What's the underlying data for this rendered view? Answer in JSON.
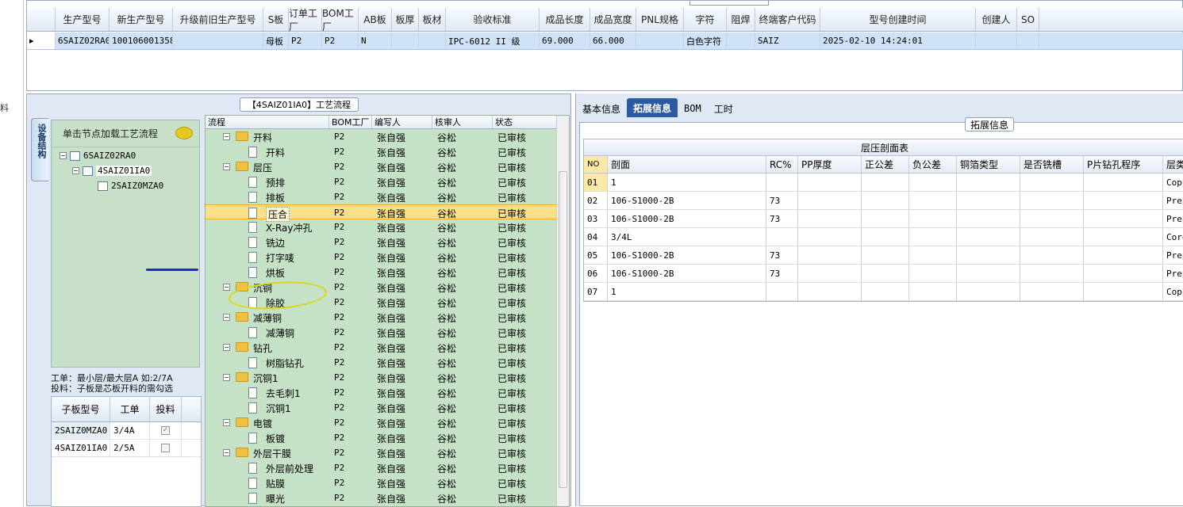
{
  "left_strip_text": "料",
  "top_grid": {
    "headers": [
      "生产型号",
      "新生产型号",
      "升级前旧生产型号",
      "S板",
      "订单工厂",
      "BOM工厂",
      "AB板",
      "板厚",
      "板材",
      "验收标准",
      "成品长度",
      "成品宽度",
      "PNL规格",
      "字符",
      "阻焊",
      "终端客户代码",
      "型号创建时间",
      "创建人",
      "SO"
    ],
    "row": {
      "indicator": "▸",
      "cells": [
        "6SAIZ02RA0",
        "10010600135860",
        "",
        "母板",
        "P2",
        "P2",
        "N",
        "",
        "",
        "IPC-6012 II 级",
        "69.000",
        "66.000",
        "",
        "白色字符",
        "",
        "SAIZ",
        "2025-02-10 14:24:01",
        "",
        ""
      ]
    }
  },
  "left_panel": {
    "title": "【4SAIZ01IA0】工艺流程",
    "vertical_tab": "设备结构",
    "tree_header": "单击节点加载工艺流程",
    "tree": [
      {
        "label": "6SAIZ02RA0"
      },
      {
        "label": "4SAIZ01IA0"
      },
      {
        "label": "2SAIZ0MZA0"
      }
    ],
    "note_line1": "工单：最小层/最大层A 如:2/7A",
    "note_line2": "投料：子板是芯板开料的需勾选",
    "sub_grid": {
      "headers": [
        "子板型号",
        "工单",
        "投料"
      ],
      "rows": [
        {
          "model": "2SAIZ0MZA0",
          "order": "3/4A",
          "feed": "✓"
        },
        {
          "model": "4SAIZ01IA0",
          "order": "2/5A",
          "feed": ""
        }
      ]
    }
  },
  "flow": {
    "headers": [
      "流程",
      "BOM工厂",
      "编写人",
      "核审人",
      "状态"
    ],
    "rows": [
      {
        "name": "开料",
        "type": "folder",
        "bom": "P2",
        "writer": "张自强",
        "reviewer": "谷松",
        "status": "已审核"
      },
      {
        "name": "开料",
        "type": "doc",
        "bom": "P2",
        "writer": "张自强",
        "reviewer": "谷松",
        "status": "已审核"
      },
      {
        "name": "层压",
        "type": "folder",
        "bom": "P2",
        "writer": "张自强",
        "reviewer": "谷松",
        "status": "已审核"
      },
      {
        "name": "预排",
        "type": "doc",
        "bom": "P2",
        "writer": "张自强",
        "reviewer": "谷松",
        "status": "已审核"
      },
      {
        "name": "排板",
        "type": "doc",
        "bom": "P2",
        "writer": "张自强",
        "reviewer": "谷松",
        "status": "已审核"
      },
      {
        "name": "压合",
        "type": "doc",
        "bom": "P2",
        "writer": "张自强",
        "reviewer": "谷松",
        "status": "已审核",
        "selected": true
      },
      {
        "name": "X-Ray冲孔",
        "type": "doc",
        "bom": "P2",
        "writer": "张自强",
        "reviewer": "谷松",
        "status": "已审核"
      },
      {
        "name": "铣边",
        "type": "doc",
        "bom": "P2",
        "writer": "张自强",
        "reviewer": "谷松",
        "status": "已审核"
      },
      {
        "name": "打字唛",
        "type": "doc",
        "bom": "P2",
        "writer": "张自强",
        "reviewer": "谷松",
        "status": "已审核"
      },
      {
        "name": "烘板",
        "type": "doc",
        "bom": "P2",
        "writer": "张自强",
        "reviewer": "谷松",
        "status": "已审核"
      },
      {
        "name": "沉铜",
        "type": "folder",
        "bom": "P2",
        "writer": "张自强",
        "reviewer": "谷松",
        "status": "已审核"
      },
      {
        "name": "除胶",
        "type": "doc",
        "bom": "P2",
        "writer": "张自强",
        "reviewer": "谷松",
        "status": "已审核"
      },
      {
        "name": "减薄铜",
        "type": "folder",
        "bom": "P2",
        "writer": "张自强",
        "reviewer": "谷松",
        "status": "已审核"
      },
      {
        "name": "减薄铜",
        "type": "doc",
        "bom": "P2",
        "writer": "张自强",
        "reviewer": "谷松",
        "status": "已审核"
      },
      {
        "name": "钻孔",
        "type": "folder",
        "bom": "P2",
        "writer": "张自强",
        "reviewer": "谷松",
        "status": "已审核"
      },
      {
        "name": "树脂钻孔",
        "type": "doc",
        "bom": "P2",
        "writer": "张自强",
        "reviewer": "谷松",
        "status": "已审核"
      },
      {
        "name": "沉铜1",
        "type": "folder",
        "bom": "P2",
        "writer": "张自强",
        "reviewer": "谷松",
        "status": "已审核"
      },
      {
        "name": "去毛刺1",
        "type": "doc",
        "bom": "P2",
        "writer": "张自强",
        "reviewer": "谷松",
        "status": "已审核"
      },
      {
        "name": "沉铜1",
        "type": "doc",
        "bom": "P2",
        "writer": "张自强",
        "reviewer": "谷松",
        "status": "已审核"
      },
      {
        "name": "电镀",
        "type": "folder",
        "bom": "P2",
        "writer": "张自强",
        "reviewer": "谷松",
        "status": "已审核"
      },
      {
        "name": "板镀",
        "type": "doc",
        "bom": "P2",
        "writer": "张自强",
        "reviewer": "谷松",
        "status": "已审核"
      },
      {
        "name": "外层干膜",
        "type": "folder",
        "bom": "P2",
        "writer": "张自强",
        "reviewer": "谷松",
        "status": "已审核"
      },
      {
        "name": "外层前处理",
        "type": "doc",
        "bom": "P2",
        "writer": "张自强",
        "reviewer": "谷松",
        "status": "已审核"
      },
      {
        "name": "贴膜",
        "type": "doc",
        "bom": "P2",
        "writer": "张自强",
        "reviewer": "谷松",
        "status": "已审核"
      },
      {
        "name": "曝光",
        "type": "doc",
        "bom": "P2",
        "writer": "张自强",
        "reviewer": "谷松",
        "status": "已审核"
      }
    ]
  },
  "right_panel": {
    "tabs": [
      "基本信息",
      "拓展信息",
      "BOM",
      "工时"
    ],
    "active_tab": "拓展信息",
    "group_title": "拓展信息",
    "table_caption": "层压剖面表",
    "headers": [
      "NO",
      "剖面",
      "RC%",
      "PP厚度",
      "正公差",
      "负公差",
      "铜箔类型",
      "是否铣槽",
      "P片钻孔程序",
      "层类"
    ],
    "rows": [
      [
        "01",
        "1",
        "",
        "",
        "",
        "",
        "",
        "",
        "",
        "Copp"
      ],
      [
        "02",
        "106-S1000-2B",
        "73",
        "",
        "",
        "",
        "",
        "",
        "",
        "Prep"
      ],
      [
        "03",
        "106-S1000-2B",
        "73",
        "",
        "",
        "",
        "",
        "",
        "",
        "Prep"
      ],
      [
        "04",
        "3/4L",
        "",
        "",
        "",
        "",
        "",
        "",
        "",
        "Core"
      ],
      [
        "05",
        "106-S1000-2B",
        "73",
        "",
        "",
        "",
        "",
        "",
        "",
        "Prep"
      ],
      [
        "06",
        "106-S1000-2B",
        "73",
        "",
        "",
        "",
        "",
        "",
        "",
        "Prep"
      ],
      [
        "07",
        "1",
        "",
        "",
        "",
        "",
        "",
        "",
        "",
        "Copp"
      ]
    ]
  },
  "colors": {
    "accent_tab": "#2a5aa0",
    "tree_bg": "#c8e0c8",
    "selection": "#fbe08a",
    "row_highlight": "#cfe2f8",
    "annotation_ellipse": "#d8d818",
    "annotation_underline": "#1a2ad0"
  }
}
